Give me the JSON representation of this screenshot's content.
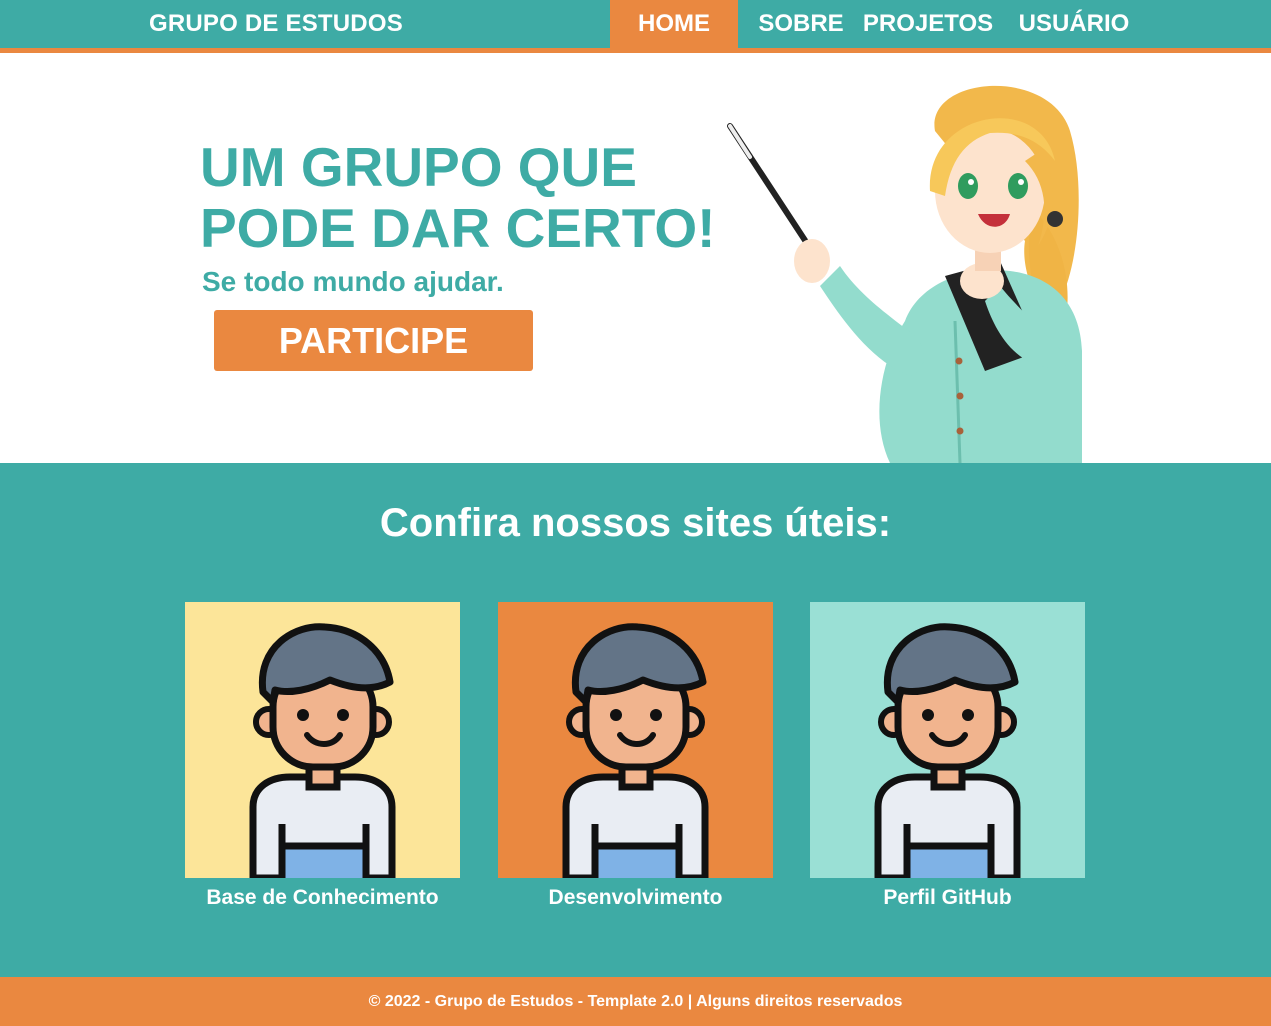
{
  "header": {
    "brand": "GRUPO DE ESTUDOS",
    "nav": [
      {
        "label": "HOME",
        "active": true
      },
      {
        "label": "SOBRE",
        "active": false
      },
      {
        "label": "PROJETOS",
        "active": false
      },
      {
        "label": "USUÁRIO",
        "active": false
      }
    ]
  },
  "hero": {
    "title": "UM GRUPO QUE PODE DAR CERTO!",
    "subtitle": "Se todo mundo ajudar.",
    "cta_label": "PARTICIPE",
    "illustration_icon": "teacher-girl-illustration"
  },
  "sites": {
    "title": "Confira nossos sites úteis:",
    "cards": [
      {
        "label": "Base de Conhecimento",
        "bg": "#fce599",
        "icon": "avatar-boy-icon"
      },
      {
        "label": "Desenvolvimento",
        "bg": "#ea8840",
        "icon": "avatar-boy-icon"
      },
      {
        "label": "Perfil GitHub",
        "bg": "#9ae0d5",
        "icon": "avatar-boy-icon"
      }
    ]
  },
  "footer": {
    "text": "© 2022 - Grupo de Estudos - Template 2.0 | Alguns direitos reservados"
  },
  "colors": {
    "teal": "#3eaba5",
    "orange": "#ea8840",
    "white": "#ffffff"
  }
}
